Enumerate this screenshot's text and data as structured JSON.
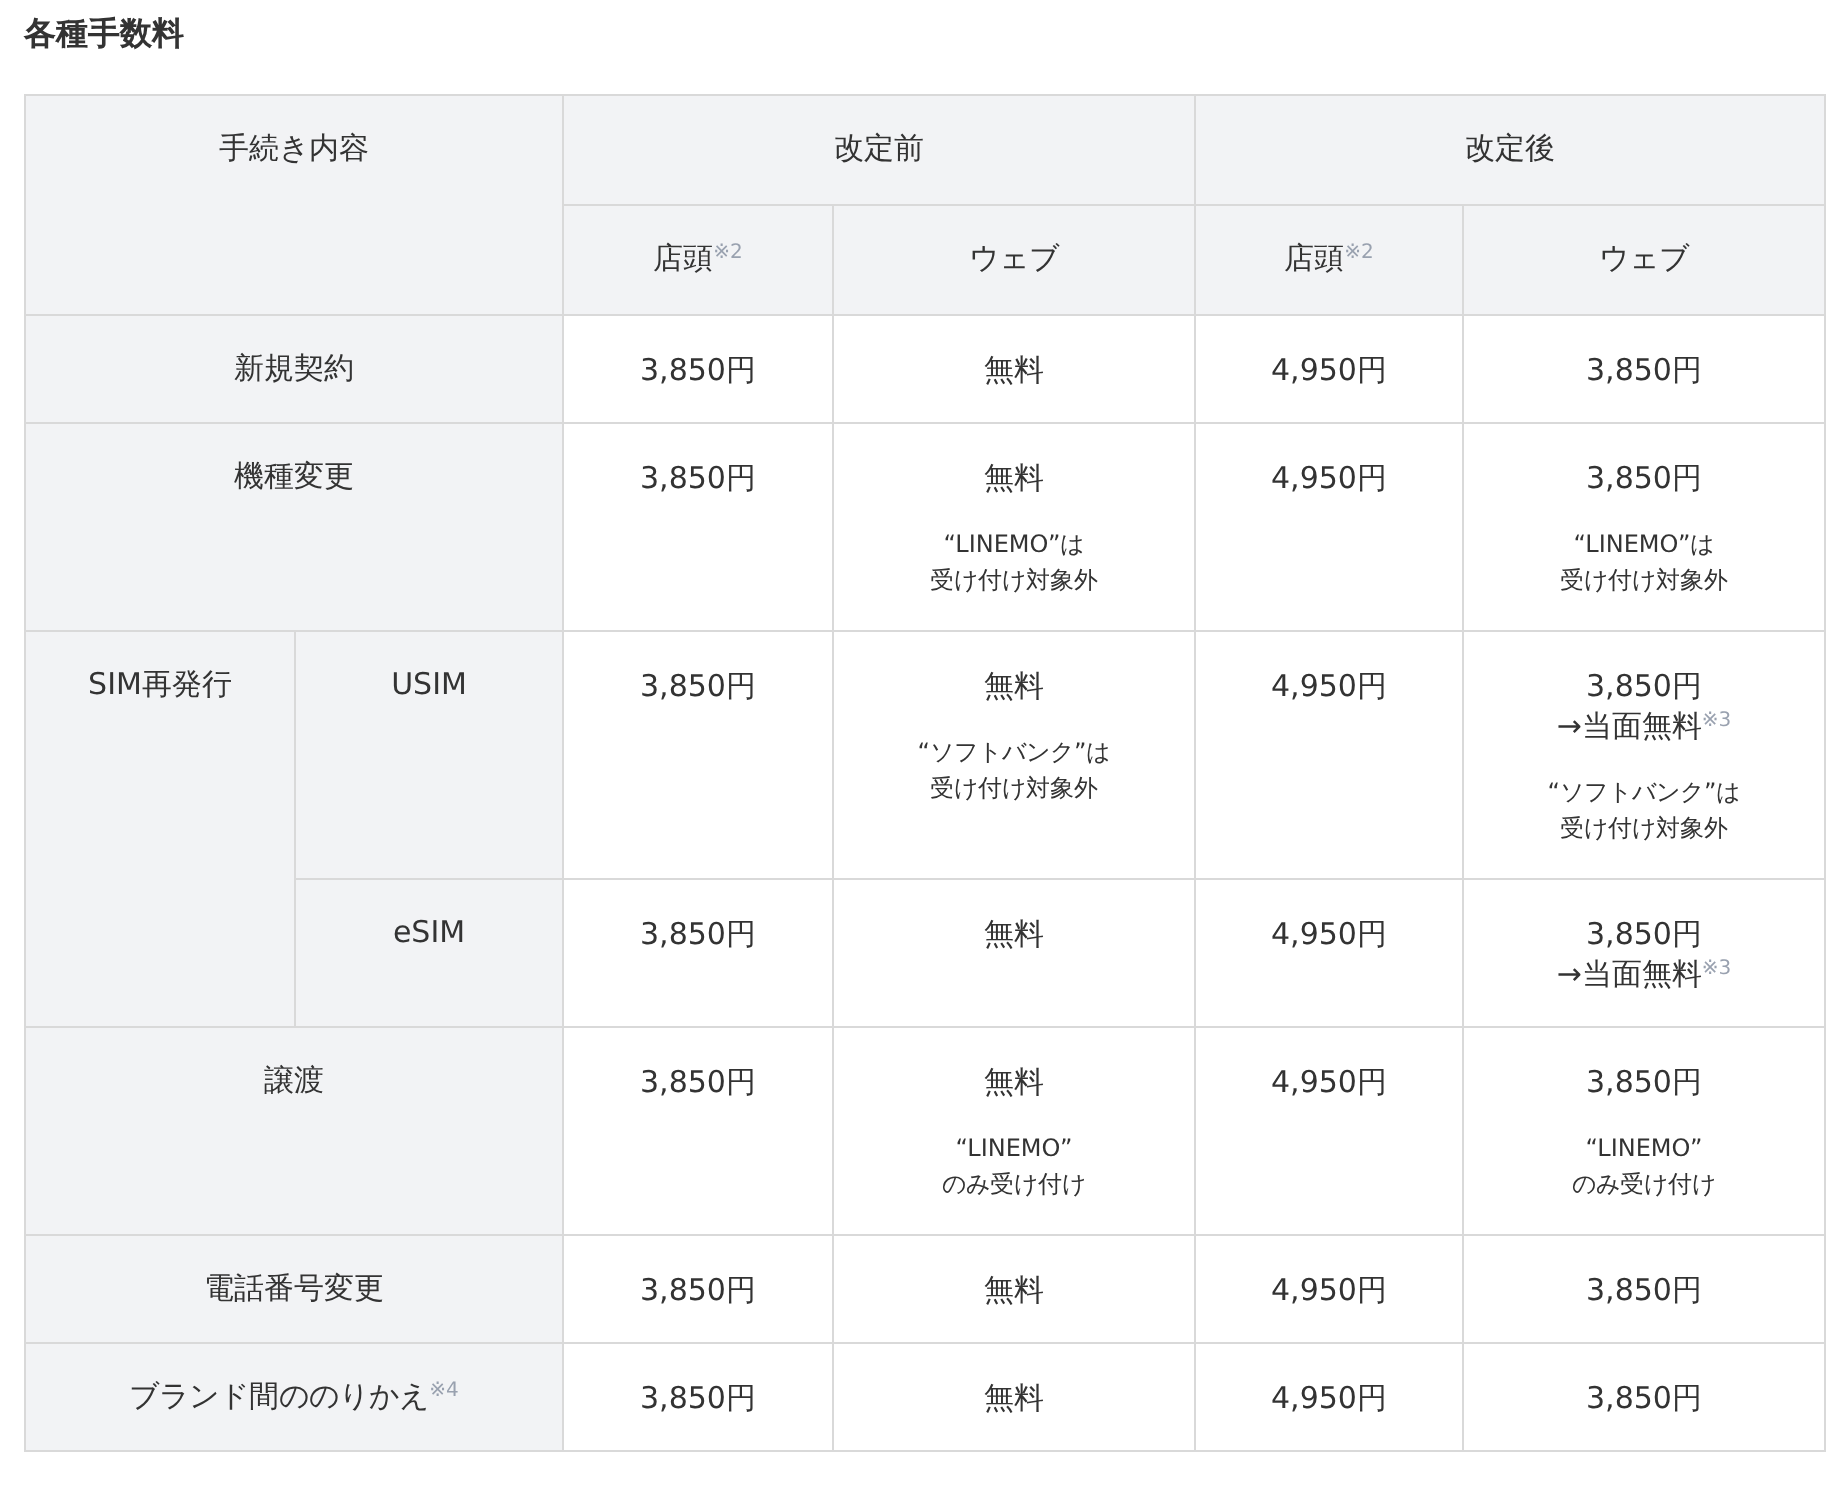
{
  "title": "各種手数料",
  "table": {
    "corner": "手続き内容",
    "groups": [
      {
        "label": "改定前",
        "columns": [
          "店頭$^{※2}$",
          "ウェブ"
        ]
      },
      {
        "label": "改定後",
        "columns": [
          "店頭$^{※2}$",
          "ウェブ"
        ]
      }
    ],
    "rows": [
      {
        "label": "新規契約",
        "cells": [
          {
            "lines": [
              "3,850円"
            ]
          },
          {
            "lines": [
              "無料"
            ]
          },
          {
            "lines": [
              "4,950円"
            ]
          },
          {
            "lines": [
              "3,850円"
            ]
          }
        ]
      },
      {
        "label": "機種変更",
        "cells": [
          {
            "lines": [
              "3,850円"
            ]
          },
          {
            "lines": [
              "無料"
            ],
            "note": [
              "“LINEMO”は",
              "受け付け対象外"
            ]
          },
          {
            "lines": [
              "4,950円"
            ]
          },
          {
            "lines": [
              "3,850円"
            ],
            "note": [
              "“LINEMO”は",
              "受け付け対象外"
            ]
          }
        ]
      },
      {
        "label": "SIM再発行",
        "children": [
          {
            "label": "USIM",
            "cells": [
              {
                "lines": [
                  "3,850円"
                ]
              },
              {
                "lines": [
                  "無料"
                ],
                "note": [
                  "“ソフトバンク”は",
                  "受け付け対象外"
                ]
              },
              {
                "lines": [
                  "4,950円"
                ]
              },
              {
                "lines": [
                  "3,850円",
                  "→当面無料$^{※3}$"
                ],
                "note": [
                  "“ソフトバンク”は",
                  "受け付け対象外"
                ]
              }
            ]
          },
          {
            "label": "eSIM",
            "cells": [
              {
                "lines": [
                  "3,850円"
                ]
              },
              {
                "lines": [
                  "無料"
                ]
              },
              {
                "lines": [
                  "4,950円"
                ]
              },
              {
                "lines": [
                  "3,850円",
                  "→当面無料$^{※3}$"
                ]
              }
            ]
          }
        ]
      },
      {
        "label": "譲渡",
        "cells": [
          {
            "lines": [
              "3,850円"
            ]
          },
          {
            "lines": [
              "無料"
            ],
            "note": [
              "“LINEMO”",
              "のみ受け付け"
            ]
          },
          {
            "lines": [
              "4,950円"
            ]
          },
          {
            "lines": [
              "3,850円"
            ],
            "note": [
              "“LINEMO”",
              "のみ受け付け"
            ]
          }
        ]
      },
      {
        "label": "電話番号変更",
        "cells": [
          {
            "lines": [
              "3,850円"
            ]
          },
          {
            "lines": [
              "無料"
            ]
          },
          {
            "lines": [
              "4,950円"
            ]
          },
          {
            "lines": [
              "3,850円"
            ]
          }
        ]
      },
      {
        "label": "ブランド間ののりかえ$^{※4}$",
        "cells": [
          {
            "lines": [
              "3,850円"
            ]
          },
          {
            "lines": [
              "無料"
            ]
          },
          {
            "lines": [
              "4,950円"
            ]
          },
          {
            "lines": [
              "3,850円"
            ]
          }
        ]
      }
    ]
  }
}
